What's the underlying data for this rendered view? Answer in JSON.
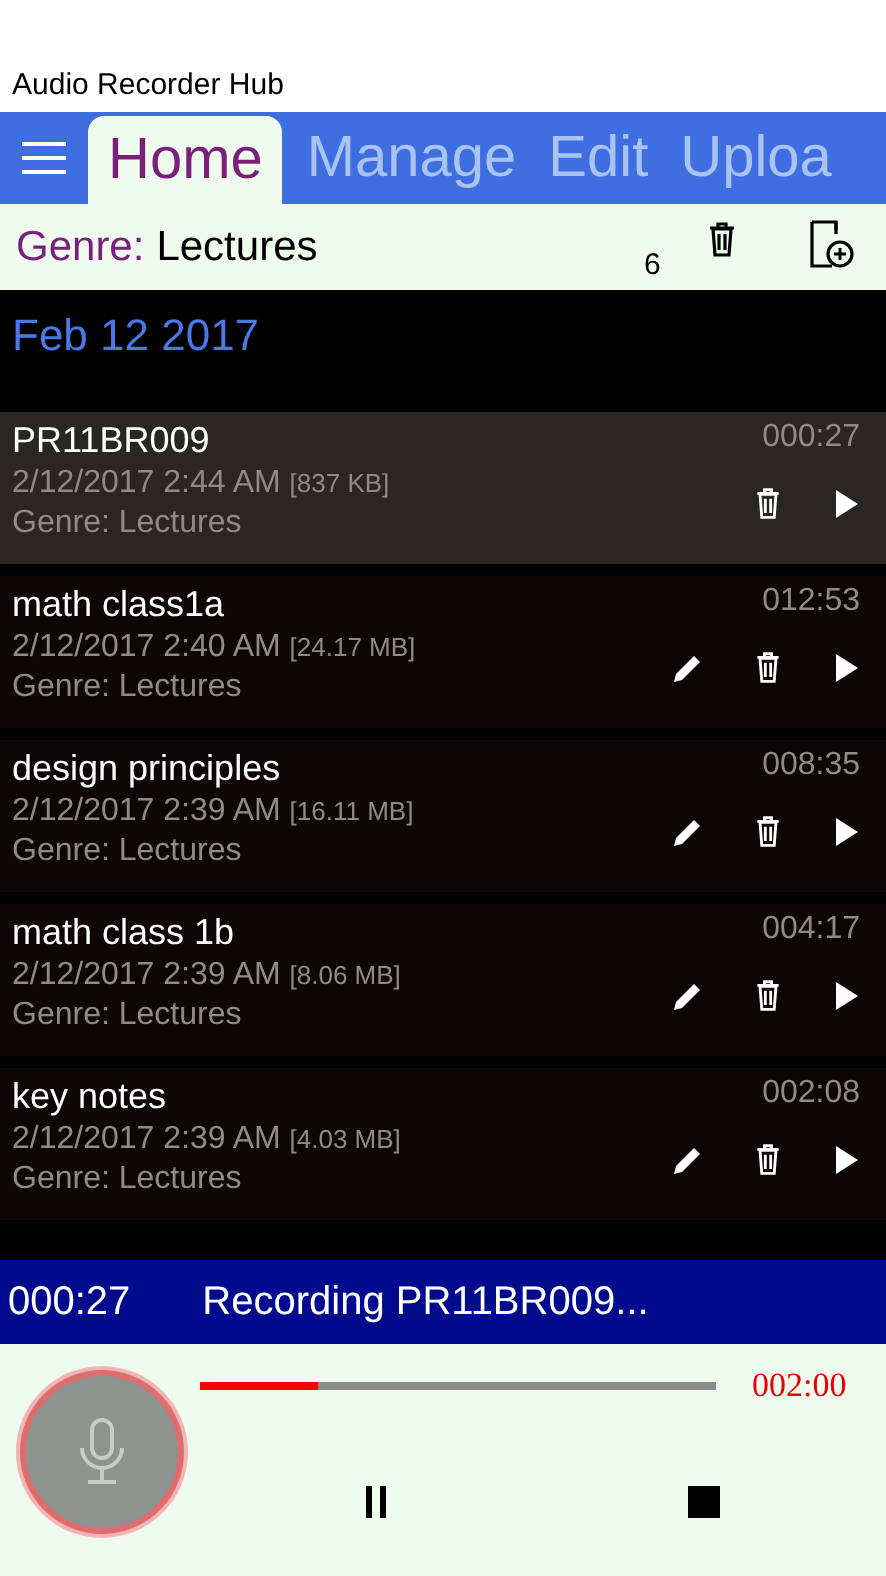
{
  "window": {
    "title": "Audio Recorder Hub"
  },
  "tabs": [
    {
      "label": "Home",
      "selected": true
    },
    {
      "label": "Manage",
      "selected": false
    },
    {
      "label": "Edit",
      "selected": false
    },
    {
      "label": "Uploa",
      "selected": false
    }
  ],
  "filter": {
    "label": "Genre:",
    "value": "Lectures",
    "count": "6"
  },
  "group": {
    "title": "Feb 12 2017"
  },
  "recordings": [
    {
      "name": "PR11BR009",
      "duration": "000:27",
      "date": "2/12/2017 2:44 AM",
      "size": "[837 KB]",
      "genre": "Genre: Lectures",
      "selected": true,
      "editable": false
    },
    {
      "name": "math class1a",
      "duration": "012:53",
      "date": "2/12/2017 2:40 AM",
      "size": "[24.17 MB]",
      "genre": "Genre: Lectures",
      "selected": false,
      "editable": true
    },
    {
      "name": "design principles",
      "duration": "008:35",
      "date": "2/12/2017 2:39 AM",
      "size": "[16.11 MB]",
      "genre": "Genre: Lectures",
      "selected": false,
      "editable": true
    },
    {
      "name": "math class 1b",
      "duration": "004:17",
      "date": "2/12/2017 2:39 AM",
      "size": "[8.06 MB]",
      "genre": "Genre: Lectures",
      "selected": false,
      "editable": true
    },
    {
      "name": "key notes",
      "duration": "002:08",
      "date": "2/12/2017 2:39 AM",
      "size": "[4.03 MB]",
      "genre": "Genre: Lectures",
      "selected": false,
      "editable": true
    }
  ],
  "status_bar": {
    "elapsed": "000:27",
    "message": "Recording PR11BR009..."
  },
  "player": {
    "level": 0.23,
    "limit": "002:00"
  }
}
